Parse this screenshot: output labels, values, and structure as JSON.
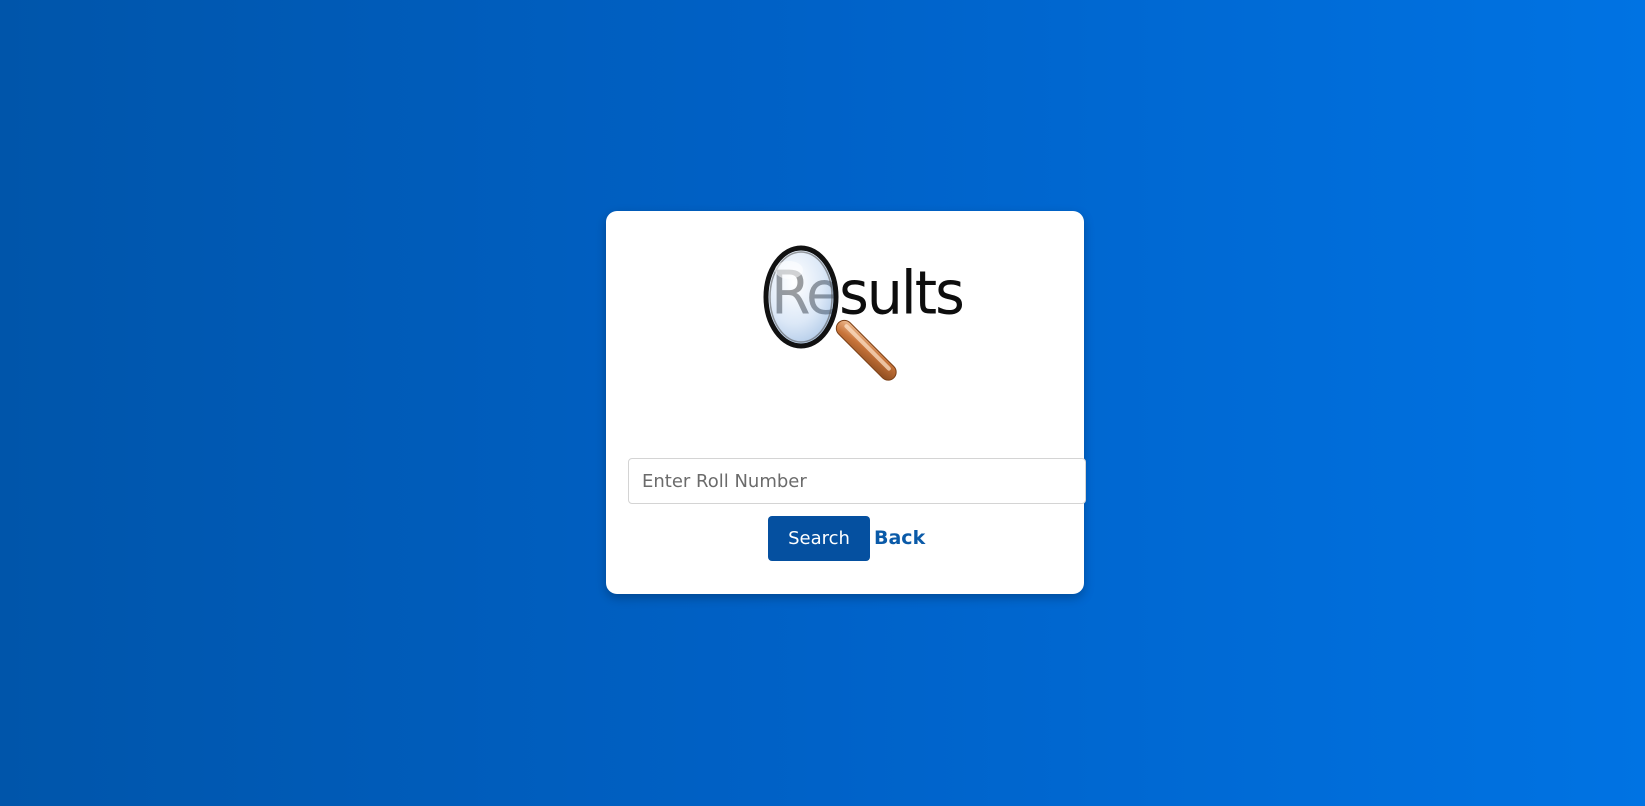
{
  "logo": {
    "text": "Results",
    "icon": "magnifying-glass-icon"
  },
  "search": {
    "placeholder": "Enter Roll Number",
    "value": "",
    "button_label": "Search"
  },
  "nav": {
    "back_label": "Back"
  },
  "colors": {
    "background_start": "#0055aa",
    "background_end": "#0073e3",
    "button": "#0550a0",
    "link": "#0a5aa8"
  }
}
